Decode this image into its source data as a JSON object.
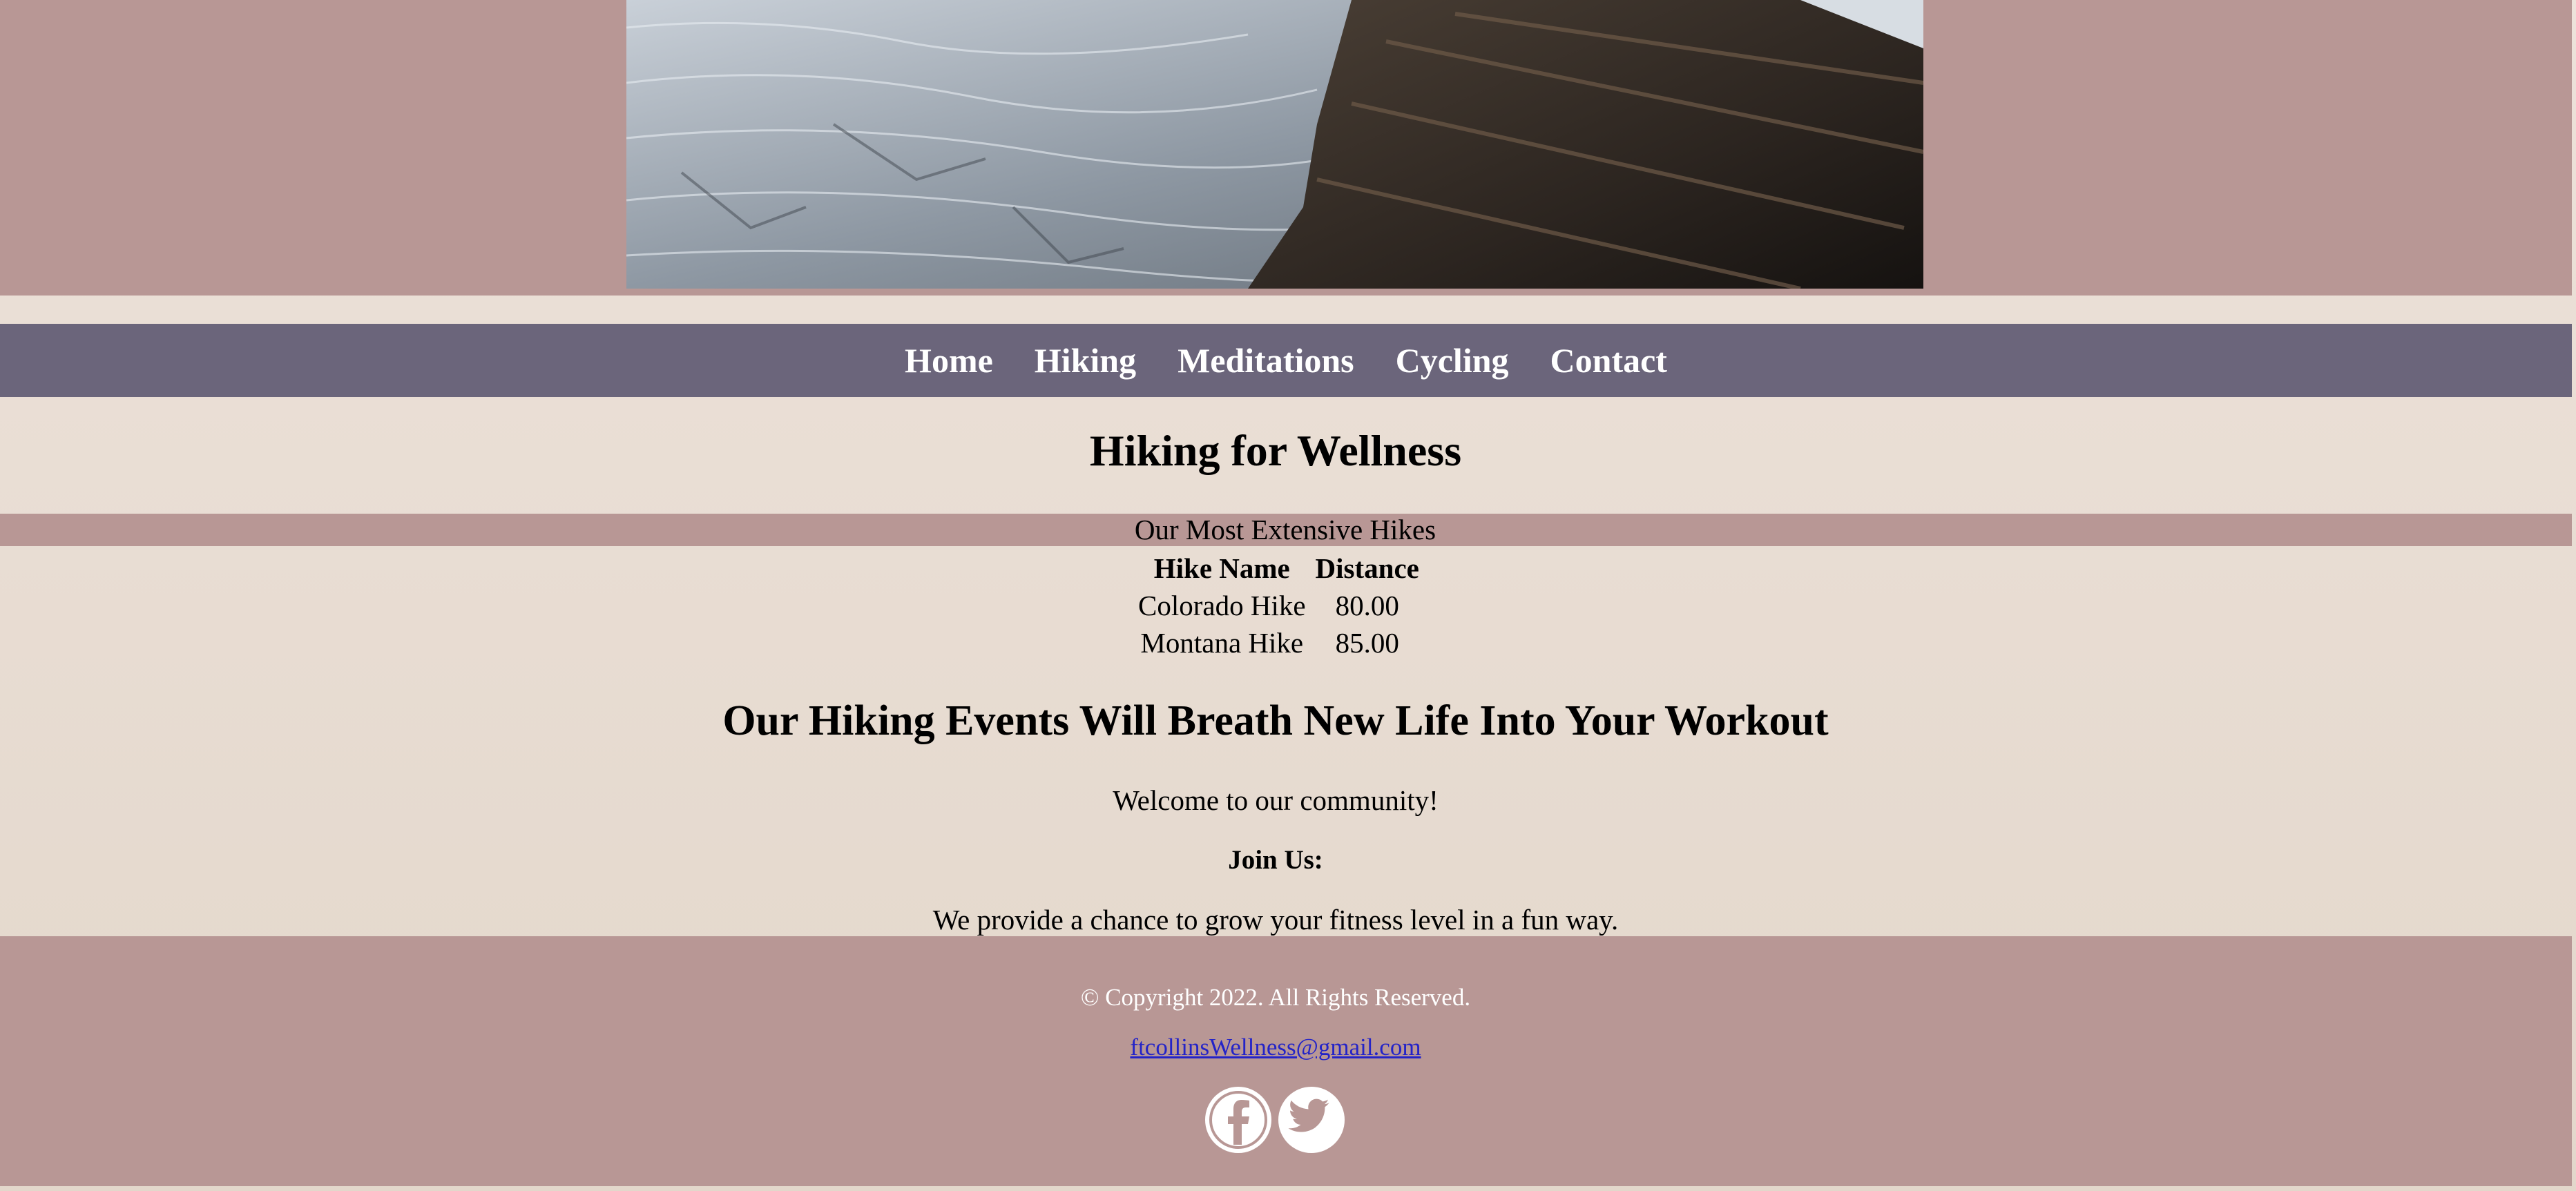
{
  "hero": {
    "alt": "Glacier and rock ridge"
  },
  "nav": {
    "items": [
      {
        "label": "Home"
      },
      {
        "label": "Hiking"
      },
      {
        "label": "Meditations"
      },
      {
        "label": "Cycling"
      },
      {
        "label": "Contact"
      }
    ]
  },
  "main": {
    "title": "Hiking for Wellness",
    "table": {
      "caption": "Our Most Extensive Hikes",
      "headers": [
        "Hike Name",
        "Distance"
      ],
      "rows": [
        [
          "Colorado Hike",
          "80.00"
        ],
        [
          "Montana Hike",
          "85.00"
        ]
      ]
    },
    "events_heading": "Our Hiking Events Will Breath New Life Into Your Workout",
    "welcome": "Welcome to our community!",
    "join_label": "Join Us:",
    "provide_text": "We provide a chance to grow your fitness level in a fun way."
  },
  "footer": {
    "copyright": "© Copyright 2022. All Rights Reserved.",
    "email": "ftcollinsWellness@gmail.com",
    "social": [
      {
        "icon": "facebook-icon"
      },
      {
        "icon": "twitter-icon"
      }
    ]
  },
  "colors": {
    "header_bg": "#b89795",
    "nav_bg": "#6b657b",
    "footer_bg": "#b89795",
    "link": "#2323c8"
  }
}
